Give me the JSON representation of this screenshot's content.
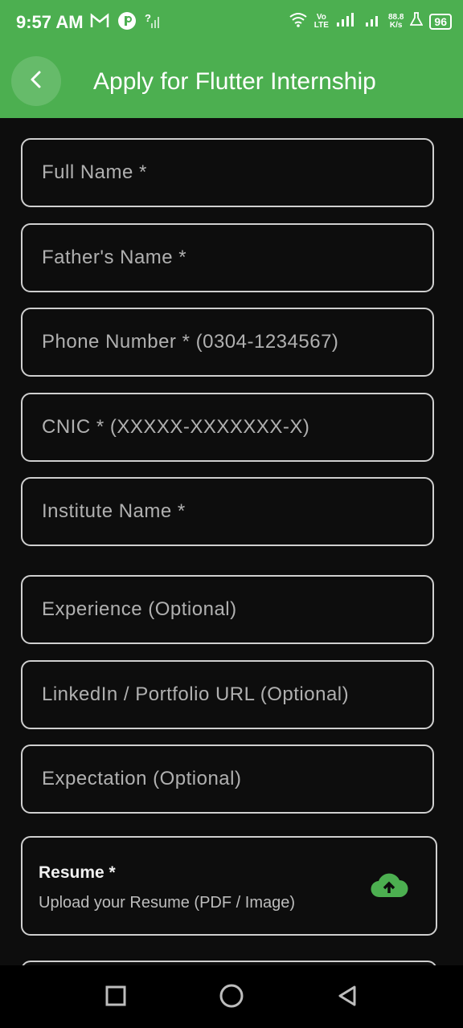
{
  "status_bar": {
    "time": "9:57 AM",
    "mail_icon": "gmail-icon",
    "app_icon": "app-notification-icon",
    "signal_icon": "no-signal-icon",
    "wifi_icon": "wifi-icon",
    "volte_top": "Vo",
    "volte_bottom": "LTE",
    "speed_top": "88.8",
    "speed_bottom": "K/s",
    "battery": "96"
  },
  "app_bar": {
    "back_icon": "chevron-left-icon",
    "title": "Apply for Flutter Internship"
  },
  "form": {
    "full_name": {
      "placeholder": "Full Name *",
      "value": ""
    },
    "father_name": {
      "placeholder": "Father's Name *",
      "value": ""
    },
    "phone": {
      "placeholder": "Phone Number * (0304-1234567)",
      "value": ""
    },
    "cnic": {
      "placeholder": "CNIC * (XXXXX-XXXXXXX-X)",
      "value": ""
    },
    "institute": {
      "placeholder": "Institute Name *",
      "value": ""
    },
    "experience": {
      "placeholder": "Experience (Optional)",
      "value": ""
    },
    "linkedin": {
      "placeholder": "LinkedIn / Portfolio URL (Optional)",
      "value": ""
    },
    "expectation": {
      "placeholder": "Expectation (Optional)",
      "value": ""
    },
    "resume": {
      "title": "Resume *",
      "subtitle": "Upload your Resume (PDF / Image)",
      "icon": "cloud-upload-icon",
      "accent": "#4caf50"
    }
  },
  "colors": {
    "primary": "#4caf50",
    "background": "#0d0d0d",
    "border": "#cfcfcf"
  },
  "nav_bar": {
    "recent_icon": "square-icon",
    "home_icon": "circle-icon",
    "back_icon": "triangle-back-icon"
  }
}
